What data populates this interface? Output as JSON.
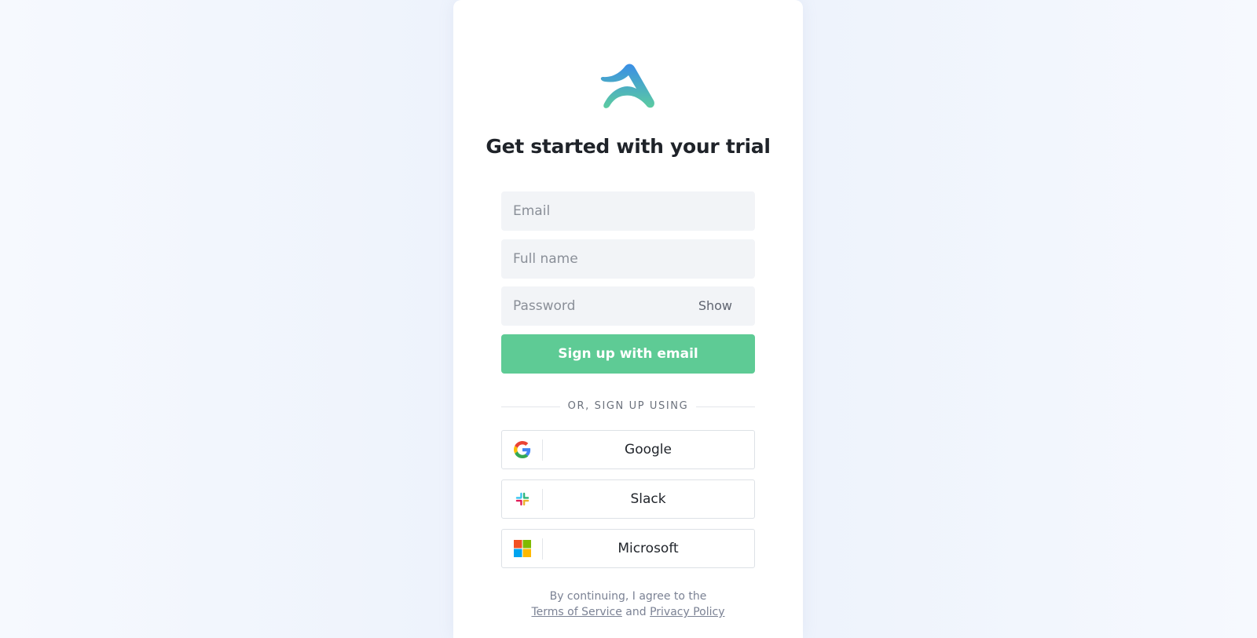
{
  "header": {
    "title": "Get started with your trial"
  },
  "form": {
    "email_placeholder": "Email",
    "fullname_placeholder": "Full name",
    "password_placeholder": "Password",
    "show_label": "Show",
    "submit_label": "Sign up with email"
  },
  "divider": {
    "text": "OR, SIGN UP USING"
  },
  "sso": [
    {
      "label": "Google",
      "icon": "google-icon"
    },
    {
      "label": "Slack",
      "icon": "slack-icon"
    },
    {
      "label": "Microsoft",
      "icon": "microsoft-icon"
    }
  ],
  "legal": {
    "prefix": "By continuing, I agree to the",
    "terms": "Terms of Service",
    "and": "and",
    "privacy": "Privacy Policy"
  },
  "colors": {
    "primary": "#5ecb95",
    "logo_top": "#3a8ee6",
    "logo_bottom": "#5ccca0"
  }
}
